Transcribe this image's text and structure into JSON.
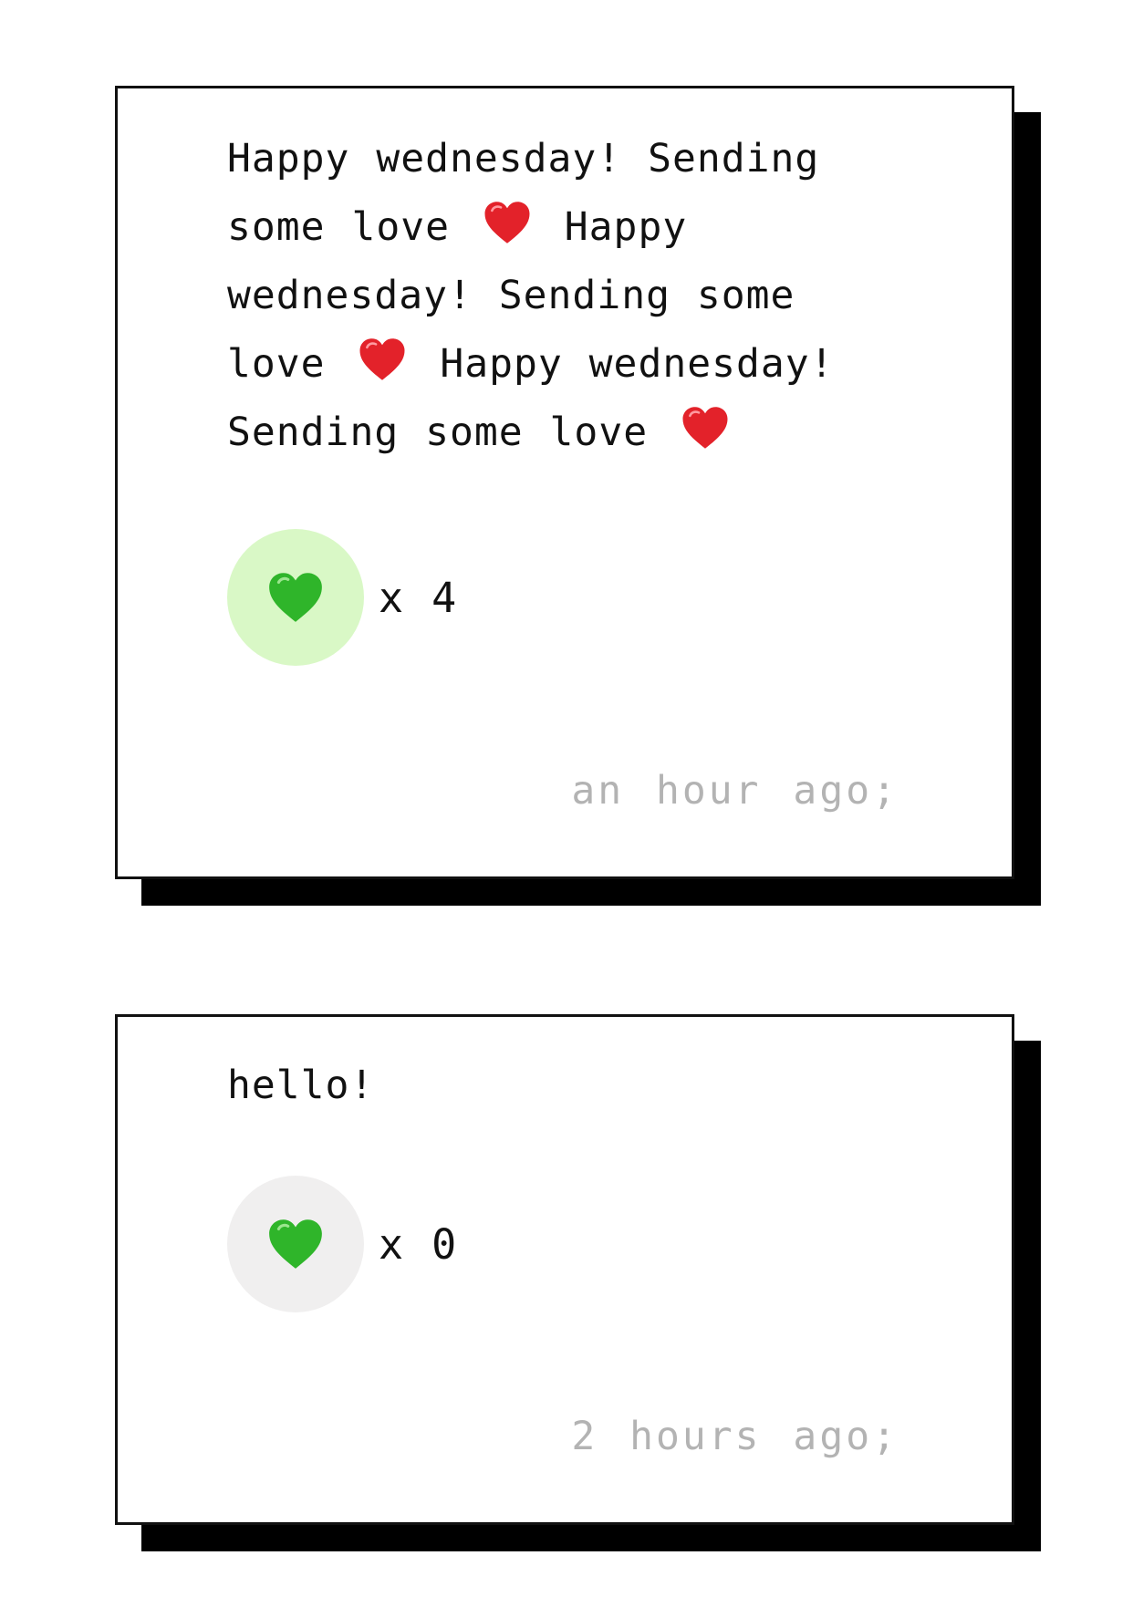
{
  "posts": [
    {
      "message": "Happy wednesday! Sending some love ❤️ Happy wednesday! Sending some love ❤️ Happy wednesday! Sending some love ❤️",
      "segments": [
        "Happy wednesday! Sending some love",
        "Happy wednesday! Sending some love",
        "Happy wednesday! Sending some love"
      ],
      "reaction": {
        "icon": "green-heart-icon",
        "count_label": "x 4",
        "count": 4,
        "button_color": "#d9f8c6"
      },
      "timestamp": "an hour ago;"
    },
    {
      "message": "hello!",
      "reaction": {
        "icon": "green-heart-icon",
        "count_label": "x 0",
        "count": 0,
        "button_color": "#f0efef"
      },
      "timestamp": "2 hours ago;"
    }
  ],
  "colors": {
    "red_heart": "#e3222a",
    "green_heart": "#3cbf2c",
    "timestamp": "#b3b3b3",
    "card_shadow": "#000000"
  }
}
